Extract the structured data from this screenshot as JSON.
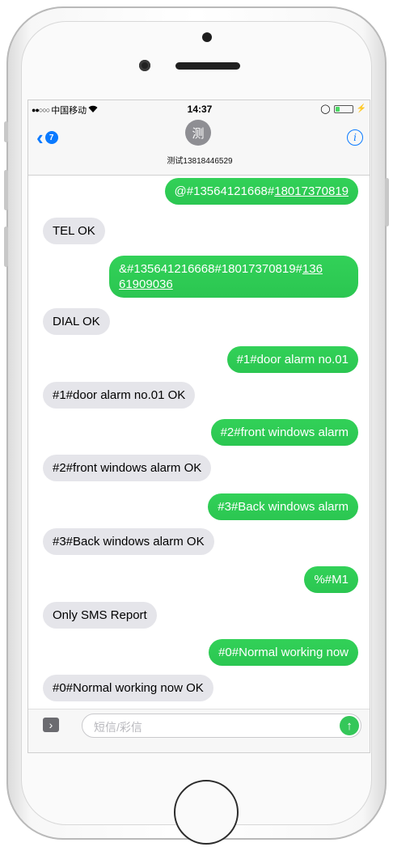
{
  "status_bar": {
    "carrier": "中国移动",
    "wifi_icon": "wifi-icon",
    "time": "14:37"
  },
  "nav": {
    "back_badge": "7",
    "avatar_char": "测",
    "contact": "测试13818446529",
    "info_icon": "info-icon"
  },
  "messages": [
    {
      "dir": "sent",
      "text": "@#13564121668#",
      "link": "18017370819"
    },
    {
      "dir": "recv",
      "text": "TEL OK"
    },
    {
      "dir": "sent",
      "text": "&#135641216668#18017370819#",
      "link": "136",
      "line2": "61909036"
    },
    {
      "dir": "recv",
      "text": "DIAL OK"
    },
    {
      "dir": "sent",
      "text": "#1#door alarm no.01"
    },
    {
      "dir": "recv",
      "text": "#1#door alarm no.01 OK"
    },
    {
      "dir": "sent",
      "text": "#2#front windows alarm"
    },
    {
      "dir": "recv",
      "text": "#2#front windows alarm OK"
    },
    {
      "dir": "sent",
      "text": "#3#Back windows alarm"
    },
    {
      "dir": "recv",
      "text": "#3#Back windows alarm OK"
    },
    {
      "dir": "sent",
      "text": "%#M1"
    },
    {
      "dir": "recv",
      "text": "Only SMS Report"
    },
    {
      "dir": "sent",
      "text": "#0#Normal working now"
    },
    {
      "dir": "recv",
      "text": "#0#Normal working now OK"
    }
  ],
  "composer": {
    "placeholder": "短信/彩信"
  },
  "colors": {
    "sent_bubble": "#2bc651",
    "recv_bubble": "#e5e5ea",
    "ios_blue": "#0a7aff"
  }
}
